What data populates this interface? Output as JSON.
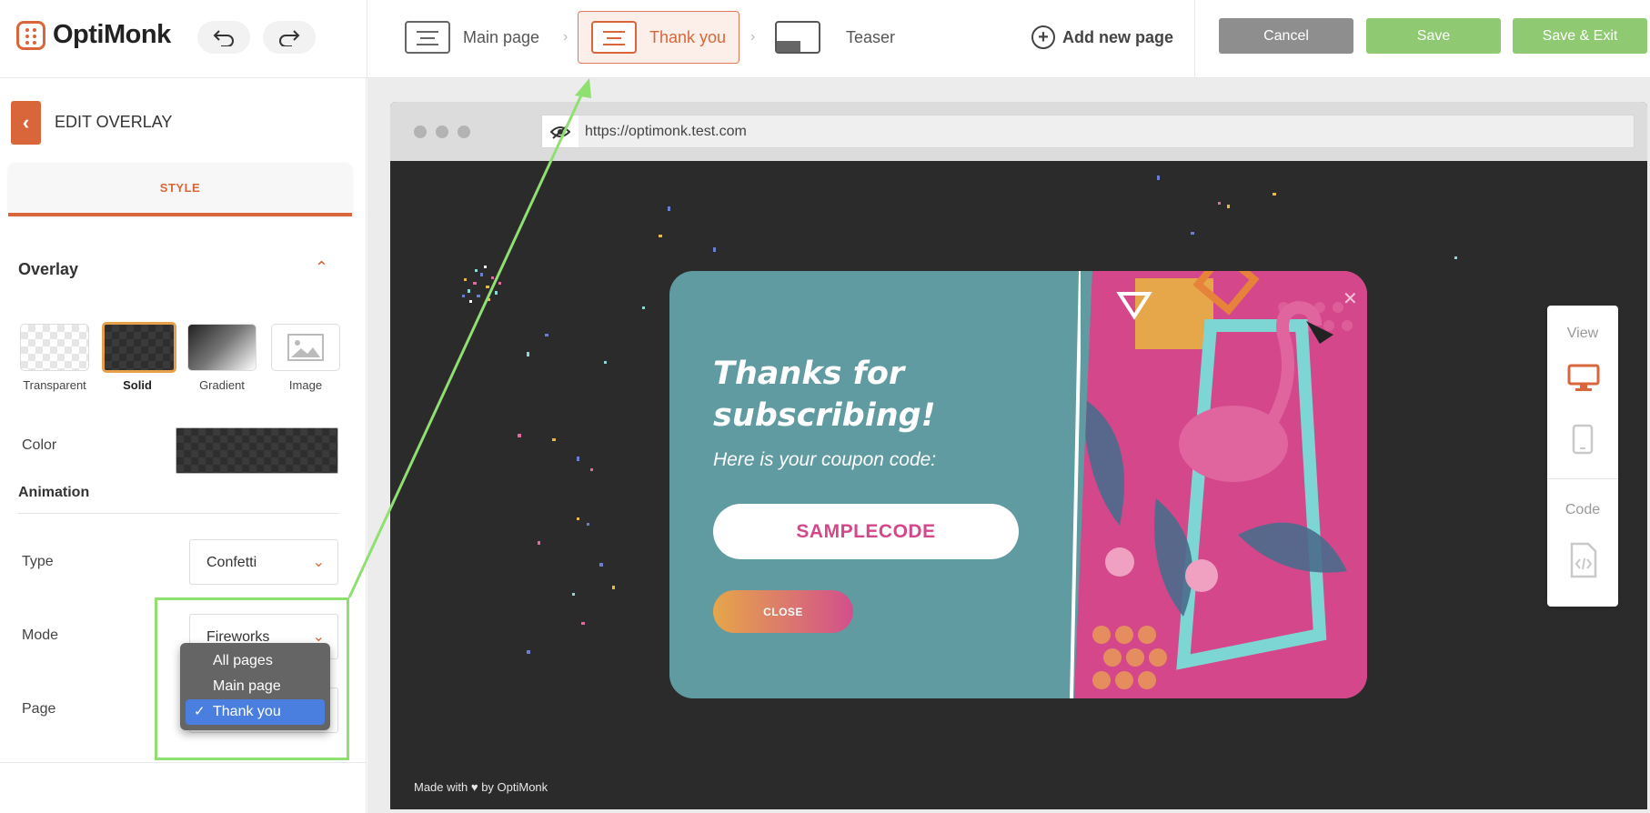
{
  "app": {
    "name": "OptiMonk"
  },
  "toolbar": {
    "undo_icon": "undo-icon",
    "redo_icon": "redo-icon"
  },
  "pages": {
    "tabs": [
      {
        "label": "Main page",
        "icon": "page-layout-icon",
        "active": false
      },
      {
        "label": "Thank you",
        "icon": "page-layout-icon",
        "active": true
      },
      {
        "label": "Teaser",
        "icon": "teaser-layout-icon",
        "active": false
      }
    ],
    "add_label": "Add new page"
  },
  "actions": {
    "cancel": "Cancel",
    "save": "Save",
    "save_exit": "Save & Exit",
    "colors": {
      "cancel": "#8e8e8e",
      "save": "#8fca72",
      "save_exit": "#8fca72"
    }
  },
  "sidebar": {
    "title": "EDIT OVERLAY",
    "tab": "STYLE",
    "overlay": {
      "heading": "Overlay",
      "options": [
        {
          "label": "Transparent",
          "selected": false
        },
        {
          "label": "Solid",
          "selected": true
        },
        {
          "label": "Gradient",
          "selected": false
        },
        {
          "label": "Image",
          "selected": false
        }
      ],
      "color_label": "Color"
    },
    "animation": {
      "heading": "Animation",
      "type_label": "Type",
      "type_value": "Confetti",
      "mode_label": "Mode",
      "mode_value": "Fireworks",
      "page_label": "Page"
    }
  },
  "dropdown": {
    "options": [
      "All pages",
      "Main page",
      "Thank you"
    ],
    "selected": "Thank you"
  },
  "preview": {
    "url": "https://optimonk.test.com",
    "made_with": "Made with ♥ by OptiMonk",
    "popup": {
      "title": "Thanks for subscribing!",
      "subtitle": "Here is your coupon code:",
      "coupon": "SAMPLECODE",
      "close_label": "CLOSE",
      "colors": {
        "left_bg": "#5f9ba1",
        "accent": "#d4478a"
      }
    }
  },
  "view_panel": {
    "view_label": "View",
    "code_label": "Code",
    "active": "desktop"
  },
  "accent_color": "#d9663b",
  "highlight_color": "#8fe070"
}
